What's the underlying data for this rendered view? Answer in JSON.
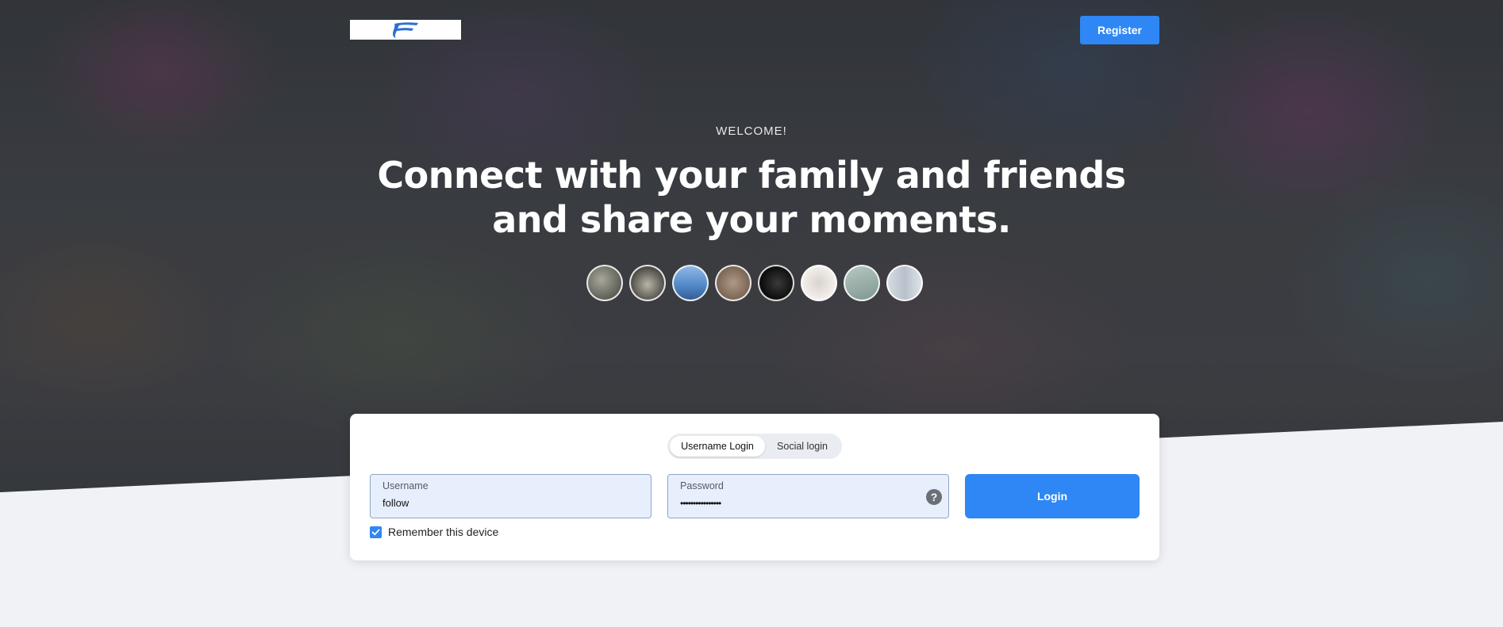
{
  "header": {
    "register_label": "Register"
  },
  "hero": {
    "welcome": "WELCOME!",
    "headline_line1": "Connect with your family and friends",
    "headline_line2": "and share your moments.",
    "avatars": [
      {
        "icon": "avatar-photo",
        "color": "#7c7d74"
      },
      {
        "icon": "avatar-photo",
        "color": "#6b6a62"
      },
      {
        "icon": "avatar-photo",
        "color": "#4f86c6"
      },
      {
        "icon": "avatar-photo",
        "color": "#a08a78"
      },
      {
        "icon": "avatar-photo",
        "color": "#111111"
      },
      {
        "icon": "avatar-photo",
        "color": "#f1ece6"
      },
      {
        "icon": "avatar-photo",
        "color": "#8ea79f"
      },
      {
        "icon": "avatar-photo",
        "color": "#c8ced6"
      }
    ]
  },
  "login": {
    "tabs": [
      "Username Login",
      "Social login"
    ],
    "username_label": "Username",
    "username_value": "follow",
    "password_label": "Password",
    "password_value": "••••••••••••••••",
    "help_glyph": "?",
    "login_label": "Login",
    "remember_label": "Remember this device",
    "remember_checked": true
  },
  "colors": {
    "accent": "#2f87f5",
    "field_bg": "#e7effd",
    "page_bg": "#f0f2f6"
  }
}
